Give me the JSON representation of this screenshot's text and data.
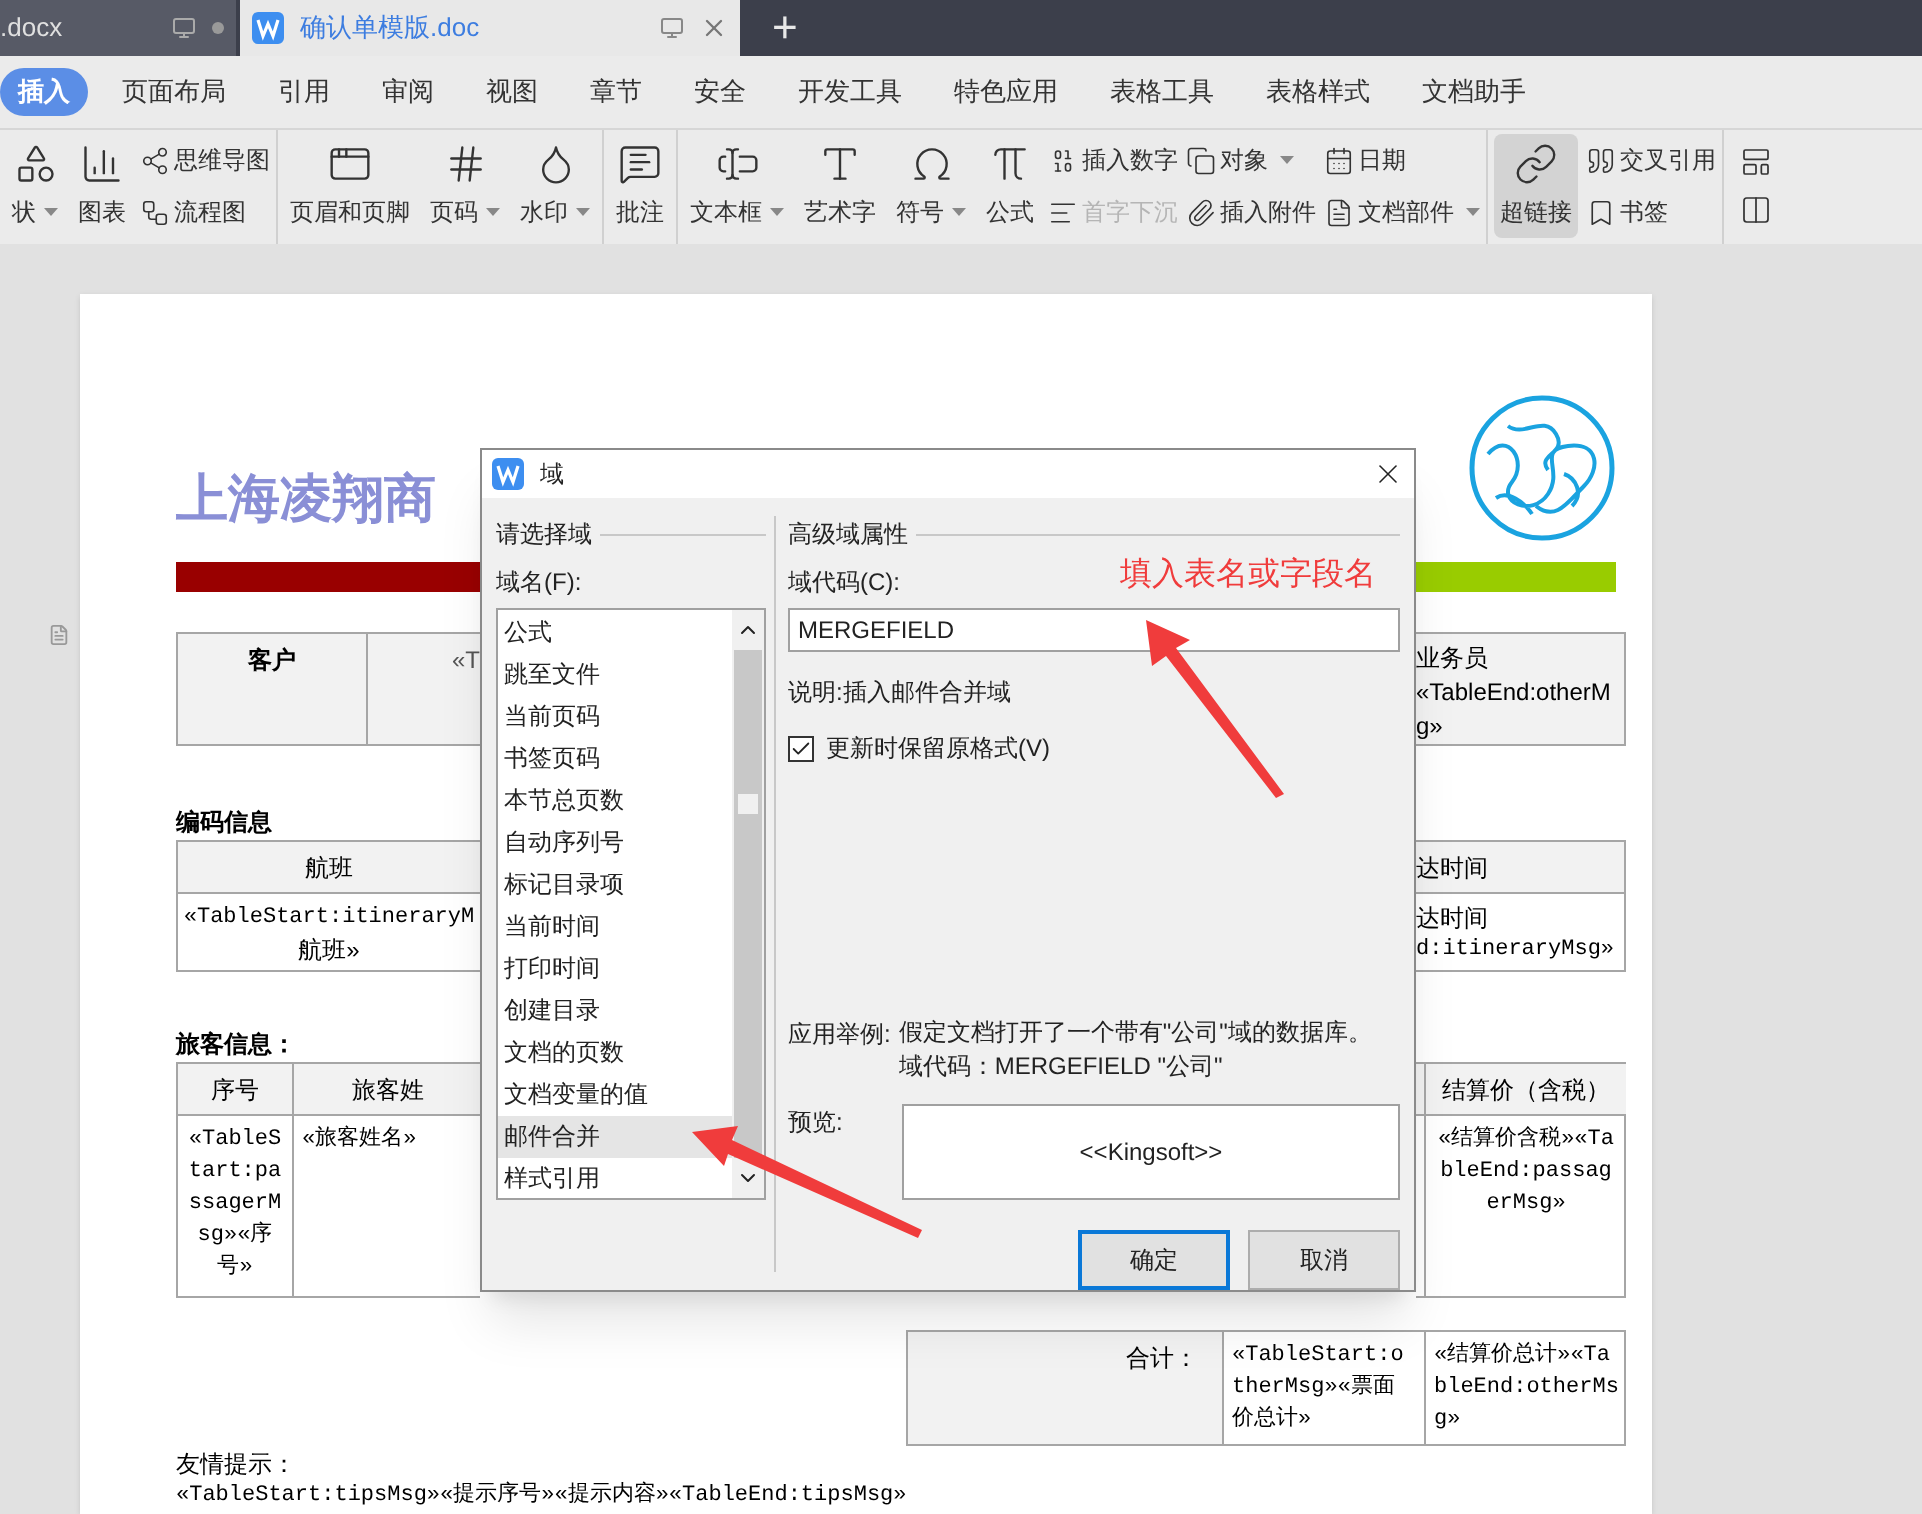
{
  "tabs": [
    {
      "label": ".docx",
      "selected": false
    },
    {
      "label": "确认单模版.doc",
      "selected": true
    }
  ],
  "new_tab": "+",
  "menu": [
    {
      "label": "插入",
      "selected": true
    },
    {
      "label": "页面布局",
      "selected": false
    },
    {
      "label": "引用",
      "selected": false
    },
    {
      "label": "审阅",
      "selected": false
    },
    {
      "label": "视图",
      "selected": false
    },
    {
      "label": "章节",
      "selected": false
    },
    {
      "label": "安全",
      "selected": false
    },
    {
      "label": "开发工具",
      "selected": false
    },
    {
      "label": "特色应用",
      "selected": false
    },
    {
      "label": "表格工具",
      "selected": false
    },
    {
      "label": "表格样式",
      "selected": false
    },
    {
      "label": "文档助手",
      "selected": false
    }
  ],
  "ribbon": [
    {
      "items": [
        {
          "kind": "large",
          "label": "状",
          "dropdown": true,
          "selected": false
        },
        {
          "kind": "large",
          "label": "图表",
          "dropdown": false,
          "selected": false
        },
        {
          "kind": "stack",
          "items": [
            {
              "label": "思维导图",
              "dropdown": false,
              "disabled": false
            },
            {
              "label": "流程图",
              "dropdown": false,
              "disabled": false
            }
          ]
        }
      ]
    },
    {
      "items": [
        {
          "kind": "large",
          "label": "页眉和页脚",
          "dropdown": false,
          "selected": false
        },
        {
          "kind": "large",
          "label": "页码",
          "dropdown": true,
          "selected": false
        },
        {
          "kind": "large",
          "label": "水印",
          "dropdown": true,
          "selected": false
        }
      ]
    },
    {
      "items": [
        {
          "kind": "large",
          "label": "批注",
          "dropdown": false,
          "selected": false
        }
      ]
    },
    {
      "items": [
        {
          "kind": "large",
          "label": "文本框",
          "dropdown": true,
          "selected": false
        },
        {
          "kind": "large",
          "label": "艺术字",
          "dropdown": false,
          "selected": false
        },
        {
          "kind": "large",
          "label": "符号",
          "dropdown": true,
          "selected": false
        },
        {
          "kind": "large",
          "label": "公式",
          "dropdown": false,
          "selected": false
        },
        {
          "kind": "stack",
          "items": [
            {
              "label": "插入数字",
              "dropdown": false,
              "disabled": false
            },
            {
              "label": "首字下沉",
              "dropdown": false,
              "disabled": true
            }
          ]
        },
        {
          "kind": "stack",
          "items": [
            {
              "label": "对象",
              "dropdown": true,
              "disabled": false
            },
            {
              "label": "插入附件",
              "dropdown": false,
              "disabled": false
            }
          ]
        },
        {
          "kind": "stack",
          "items": [
            {
              "label": "日期",
              "dropdown": false,
              "disabled": false
            },
            {
              "label": "文档部件",
              "dropdown": true,
              "disabled": false
            }
          ]
        }
      ]
    },
    {
      "items": [
        {
          "kind": "large",
          "label": "超链接",
          "dropdown": false,
          "selected": true
        },
        {
          "kind": "stack",
          "items": [
            {
              "label": "交叉引用",
              "dropdown": false,
              "disabled": false
            },
            {
              "label": "书签",
              "dropdown": false,
              "disabled": false
            }
          ]
        }
      ]
    }
  ],
  "document": {
    "title": "上海凌翔商",
    "customer_row": {
      "label": "客户",
      "value_fragment": "«T",
      "right_lines": [
        "业务员",
        "«TableEnd:otherM",
        "g»"
      ]
    },
    "section_1": "编码信息",
    "itinerary_table": {
      "header_left": "航班",
      "header_right": "达时间",
      "cell_left": [
        "«TableStart:itineraryM",
        "航班»"
      ],
      "cell_right": [
        "达时间",
        "d:itineraryMsg»"
      ]
    },
    "section_2": "旅客信息：",
    "passenger_table": {
      "headers_left": [
        "序号",
        "旅客姓"
      ],
      "header_right": "结算价（含税）",
      "cells_left": [
        "«TableStart:passagerMsg»«序号»",
        "«旅客姓名»"
      ],
      "cell_right": "«结算价含税»«TableEnd:passagerMsg»"
    },
    "total_table": [
      "合计：",
      "«TableStart:otherMsg»«票面价总计»",
      "«结算价总计»«TableEnd:otherMsg»"
    ],
    "tips_title": "友情提示：",
    "tips_code": "«TableStart:tipsMsg»«提示序号»«提示内容»«TableEnd:tipsMsg»"
  },
  "dialog": {
    "title": "域",
    "left_group": "请选择域",
    "list_label": "域名(F):",
    "fields": [
      {
        "label": "公式",
        "selected": false
      },
      {
        "label": "跳至文件",
        "selected": false
      },
      {
        "label": "当前页码",
        "selected": false
      },
      {
        "label": "书签页码",
        "selected": false
      },
      {
        "label": "本节总页数",
        "selected": false
      },
      {
        "label": "自动序列号",
        "selected": false
      },
      {
        "label": "标记目录项",
        "selected": false
      },
      {
        "label": "当前时间",
        "selected": false
      },
      {
        "label": "打印时间",
        "selected": false
      },
      {
        "label": "创建目录",
        "selected": false
      },
      {
        "label": "文档的页数",
        "selected": false
      },
      {
        "label": "文档变量的值",
        "selected": false
      },
      {
        "label": "邮件合并",
        "selected": true
      },
      {
        "label": "样式引用",
        "selected": false
      }
    ],
    "right_group": "高级域属性",
    "code_label": "域代码(C):",
    "code_value": "MERGEFIELD",
    "description": "说明:插入邮件合并域",
    "keep_format": {
      "label": "更新时保留原格式(V)",
      "checked": true
    },
    "example_label": "应用举例:",
    "example_lines": [
      "假定文档打开了一个带有\"公司\"域的数据库。",
      "域代码：MERGEFIELD \"公司\""
    ],
    "preview_label": "预览:",
    "preview": "<<Kingsoft>>",
    "buttons": [
      {
        "label": "确定",
        "default": true
      },
      {
        "label": "取消",
        "default": false
      }
    ]
  },
  "annotation": "填入表名或字段名"
}
